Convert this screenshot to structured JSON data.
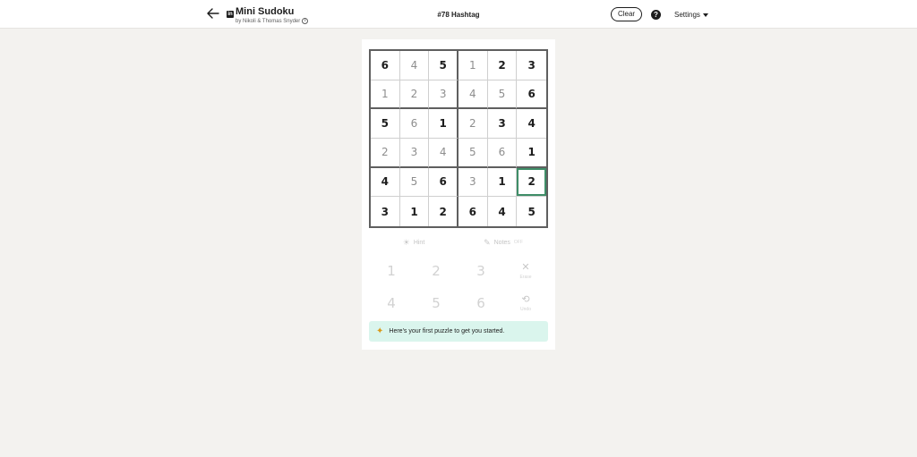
{
  "header": {
    "title": "Mini Sudoku",
    "byline": "by Nikoli & Thomas Snyder",
    "puzzle_name": "#78 Hashtag",
    "clear_label": "Clear",
    "settings_label": "Settings",
    "brand_icon_text": "in",
    "help_icon_text": "?",
    "info_icon_text": "i"
  },
  "grid": {
    "rows": [
      [
        {
          "v": "6",
          "t": "given"
        },
        {
          "v": "4",
          "t": "filled"
        },
        {
          "v": "5",
          "t": "given"
        },
        {
          "v": "1",
          "t": "filled"
        },
        {
          "v": "2",
          "t": "given"
        },
        {
          "v": "3",
          "t": "given"
        }
      ],
      [
        {
          "v": "1",
          "t": "filled"
        },
        {
          "v": "2",
          "t": "filled"
        },
        {
          "v": "3",
          "t": "filled"
        },
        {
          "v": "4",
          "t": "filled"
        },
        {
          "v": "5",
          "t": "filled"
        },
        {
          "v": "6",
          "t": "given"
        }
      ],
      [
        {
          "v": "5",
          "t": "given"
        },
        {
          "v": "6",
          "t": "filled"
        },
        {
          "v": "1",
          "t": "given"
        },
        {
          "v": "2",
          "t": "filled"
        },
        {
          "v": "3",
          "t": "given"
        },
        {
          "v": "4",
          "t": "given"
        }
      ],
      [
        {
          "v": "2",
          "t": "filled"
        },
        {
          "v": "3",
          "t": "filled"
        },
        {
          "v": "4",
          "t": "filled"
        },
        {
          "v": "5",
          "t": "filled"
        },
        {
          "v": "6",
          "t": "filled"
        },
        {
          "v": "1",
          "t": "given"
        }
      ],
      [
        {
          "v": "4",
          "t": "given"
        },
        {
          "v": "5",
          "t": "filled"
        },
        {
          "v": "6",
          "t": "given"
        },
        {
          "v": "3",
          "t": "filled"
        },
        {
          "v": "1",
          "t": "given"
        },
        {
          "v": "2",
          "t": "given"
        }
      ],
      [
        {
          "v": "3",
          "t": "given"
        },
        {
          "v": "1",
          "t": "given"
        },
        {
          "v": "2",
          "t": "given"
        },
        {
          "v": "6",
          "t": "given"
        },
        {
          "v": "4",
          "t": "given"
        },
        {
          "v": "5",
          "t": "given"
        }
      ]
    ],
    "selected": [
      4,
      5
    ]
  },
  "tools": {
    "hint_label": "Hint",
    "notes_label": "Notes",
    "notes_state": "OFF"
  },
  "keypad": {
    "row1": [
      "1",
      "2",
      "3"
    ],
    "row2": [
      "4",
      "5",
      "6"
    ],
    "erase_label": "Erase",
    "undo_label": "Undo"
  },
  "tip": {
    "text": "Here's your first puzzle to get you started."
  },
  "colors": {
    "selected_border": "#3e8d67",
    "tip_background": "#daf5ed",
    "page_background": "#f3f2ef"
  }
}
